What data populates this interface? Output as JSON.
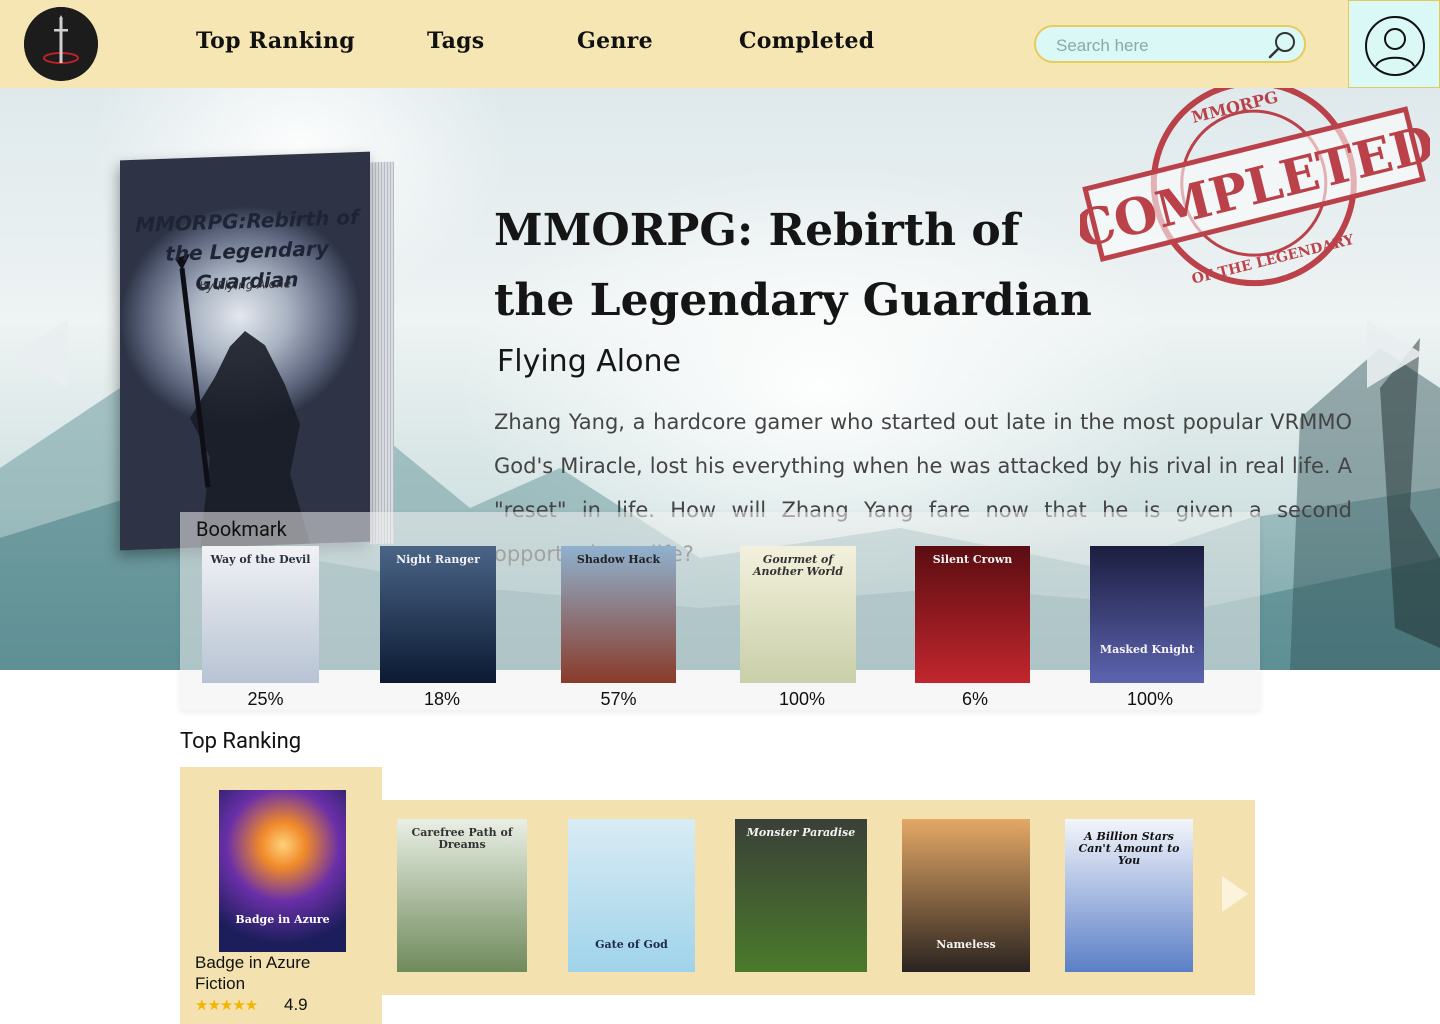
{
  "nav": {
    "items": [
      "Top Ranking",
      "Tags",
      "Genre",
      "Completed"
    ]
  },
  "search": {
    "placeholder": "Search here"
  },
  "hero": {
    "cover": {
      "title": "MMORPG:Rebirth of the Legendary Guardian",
      "author": "by Flying Alone"
    },
    "title": "MMORPG: Rebirth of the Legendary Guardian",
    "author": "Flying Alone",
    "description": "Zhang Yang, a hardcore gamer who started out late in the most popular VRMMO God's Miracle, lost his everything when he was attacked by his rival in real life. A \"reset\" in life. How will Zhang Yang fare now that he is given a second opportunity at life?",
    "stamp": {
      "text": "COMPLETED",
      "ring_top": "MMORPG",
      "ring_bottom": "OF THE LEGENDARY"
    }
  },
  "bookmark": {
    "label": "Bookmark",
    "items": [
      {
        "title": "Way of the Devil",
        "progress": "25%",
        "color_top": "#f1f2f5",
        "color_bottom": "#b7c3d4"
      },
      {
        "title": "Night Ranger",
        "progress": "18%",
        "color_top": "#4a6486",
        "color_bottom": "#0c1a33"
      },
      {
        "title": "Shadow Hack",
        "progress": "57%",
        "color_top": "#8fb2cf",
        "color_bottom": "#8a3b2a"
      },
      {
        "title": "Gourmet of Another World",
        "progress": "100%",
        "color_top": "#f3f1dd",
        "color_bottom": "#c9cfa8"
      },
      {
        "title": "Silent Crown",
        "progress": "6%",
        "color_top": "#5a0d12",
        "color_bottom": "#c2262d"
      },
      {
        "title": "Masked Knight",
        "progress": "100%",
        "color_top": "#1b1d3f",
        "color_bottom": "#5d64b0"
      }
    ]
  },
  "top_ranking": {
    "label": "Top Ranking",
    "featured": {
      "title": "Badge in Azure",
      "genre": "Fiction",
      "rating": "4.9",
      "stars": "★★★★★"
    },
    "items": [
      {
        "title": "Carefree Path of Dreams",
        "color_top": "#e9efe5",
        "color_bottom": "#6f8a5b"
      },
      {
        "title": "Gate of God",
        "color_top": "#d9ecf4",
        "color_bottom": "#9fd3ea"
      },
      {
        "title": "Monster Paradise",
        "color_top": "#3a4038",
        "color_bottom": "#4a7a2a"
      },
      {
        "title": "Nameless",
        "color_top": "#e4a866",
        "color_bottom": "#2a2320"
      },
      {
        "title": "A Billion Stars Can't Amount to You",
        "color_top": "#f3f5fb",
        "color_bottom": "#5b7fc7"
      }
    ]
  }
}
